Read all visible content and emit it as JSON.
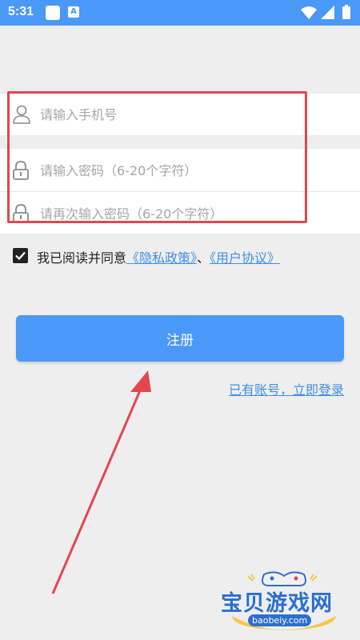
{
  "status_bar": {
    "time": "5:31",
    "app_badge": "A",
    "icons": [
      "app-icon",
      "a-icon",
      "wifi-icon",
      "signal-icon",
      "battery-icon"
    ]
  },
  "form": {
    "phone_placeholder": "请输入手机号",
    "password_placeholder": "请输入密码（6-20个字符）",
    "confirm_placeholder": "请再次输入密码（6-20个字符）",
    "icons": [
      "user-icon",
      "lock-icon",
      "lock-icon"
    ]
  },
  "agreement": {
    "checked": true,
    "prefix": "我已阅读并同意",
    "privacy_link": "《隐私政策》",
    "separator": "、",
    "user_link": "《用户协议》"
  },
  "actions": {
    "register_label": "注册",
    "login_link": "已有账号，立即登录"
  },
  "watermark": {
    "title": "宝贝游戏网",
    "url": "baobeiy.com"
  },
  "colors": {
    "primary": "#4a98f7",
    "link": "#3f8fe6",
    "annotation": "#e2474d",
    "background": "#eeeeee"
  }
}
